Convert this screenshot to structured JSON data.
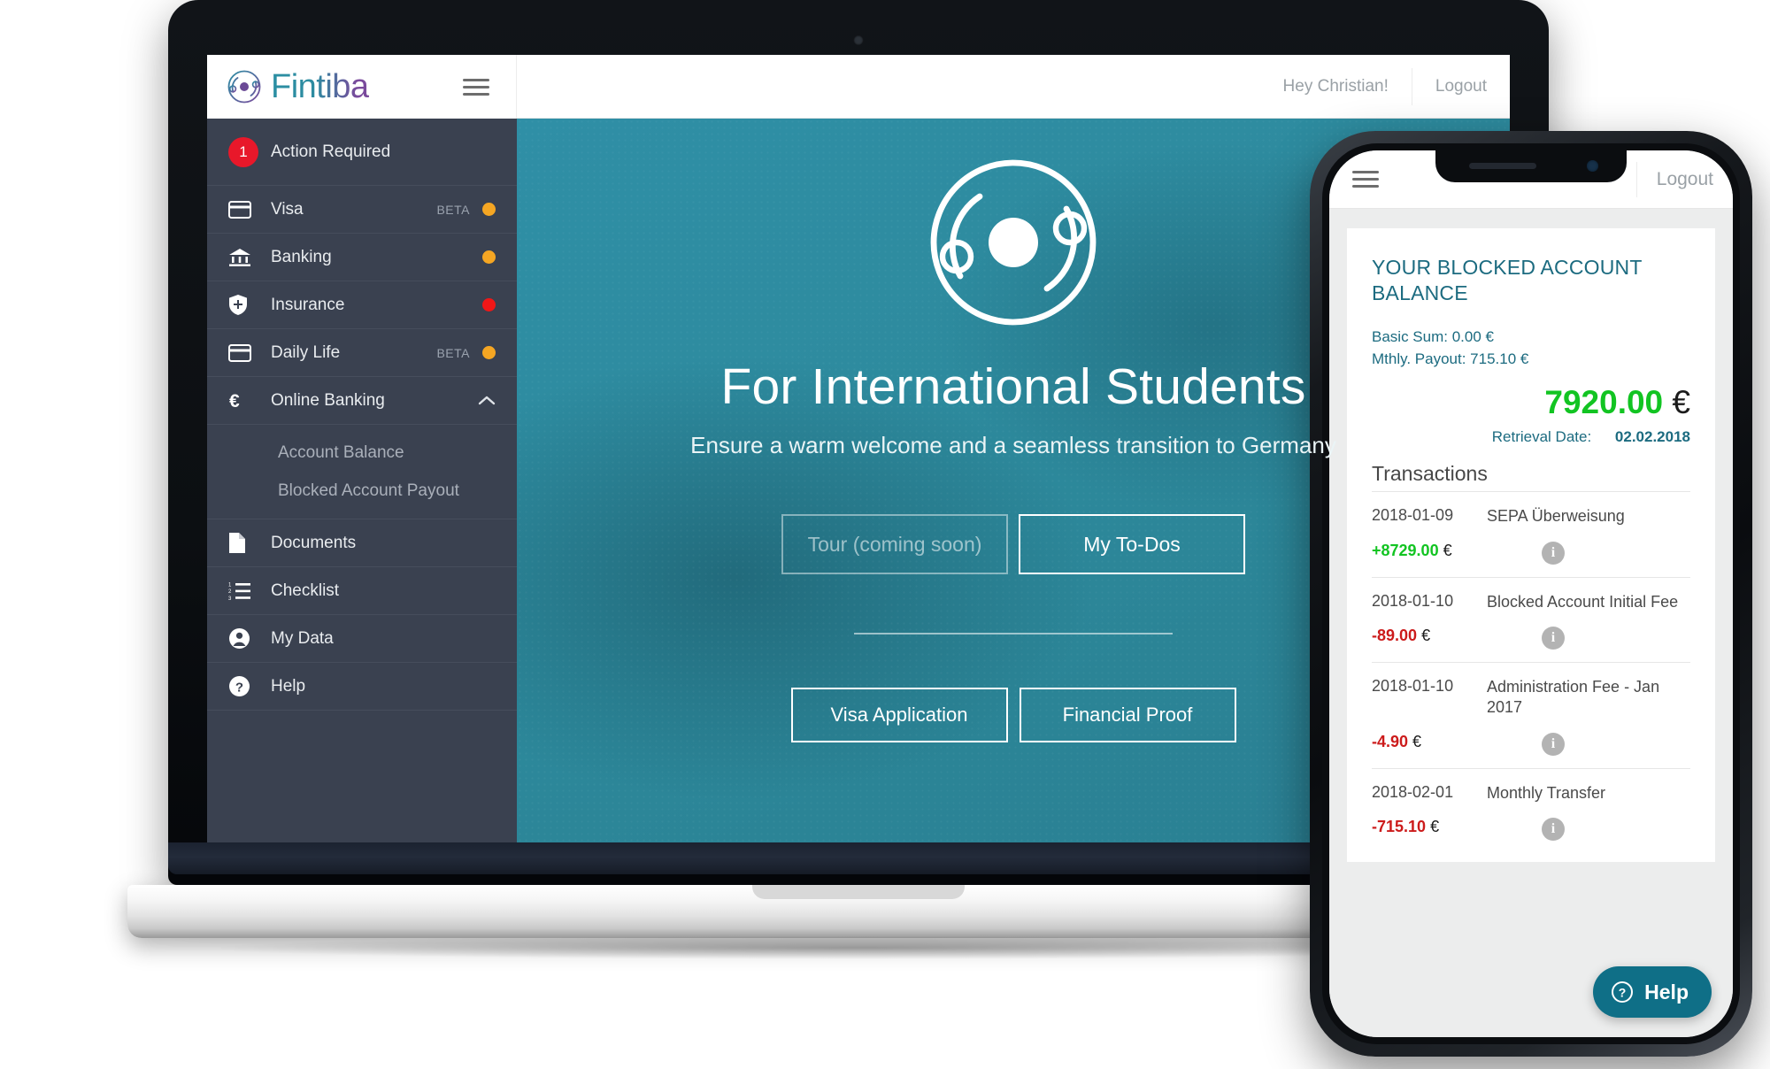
{
  "desktop": {
    "brand": {
      "name": "Fintiba"
    },
    "topbar": {
      "greeting": "Hey Christian!",
      "logout": "Logout"
    },
    "sidebar": {
      "action_required": {
        "label": "Action Required",
        "count": "1"
      },
      "items": [
        {
          "label": "Visa",
          "icon": "credit-card-icon",
          "beta": "BETA",
          "status": "amber"
        },
        {
          "label": "Banking",
          "icon": "bank-icon",
          "beta": "",
          "status": "amber"
        },
        {
          "label": "Insurance",
          "icon": "shield-icon",
          "beta": "",
          "status": "red"
        },
        {
          "label": "Daily Life",
          "icon": "credit-card-icon",
          "beta": "BETA",
          "status": "amber"
        }
      ],
      "online_banking": {
        "label": "Online Banking",
        "icon": "euro-icon",
        "expanded": true
      },
      "subitems": [
        {
          "label": "Account Balance"
        },
        {
          "label": "Blocked Account Payout"
        }
      ],
      "bottom_items": [
        {
          "label": "Documents",
          "icon": "document-icon"
        },
        {
          "label": "Checklist",
          "icon": "numbered-list-icon"
        },
        {
          "label": "My Data",
          "icon": "user-circle-icon"
        },
        {
          "label": "Help",
          "icon": "question-circle-icon"
        }
      ]
    },
    "hero": {
      "headline": "For International Students",
      "subheadline": "Ensure a warm welcome and a seamless transition to Germany",
      "primary_buttons": [
        {
          "label": "Tour (coming soon)",
          "disabled": true
        },
        {
          "label": "My To-Dos",
          "disabled": false
        }
      ],
      "secondary_buttons": [
        {
          "label": "Visa Application"
        },
        {
          "label": "Financial Proof"
        }
      ]
    }
  },
  "phone": {
    "topbar": {
      "logout": "Logout"
    },
    "card": {
      "title": "YOUR BLOCKED ACCOUNT BALANCE",
      "basic_sum": "Basic Sum: 0.00 €",
      "monthly_payout": "Mthly. Payout: 715.10 €",
      "balance_amount": "7920.00",
      "balance_currency": "€",
      "retrieval_label": "Retrieval Date:",
      "retrieval_date": "02.02.2018",
      "transactions_heading": "Transactions",
      "transactions": [
        {
          "date": "2018-01-09",
          "description": "SEPA Überweisung",
          "amount": "+8729.00",
          "currency": "€",
          "sign": "pos"
        },
        {
          "date": "2018-01-10",
          "description": "Blocked Account Initial Fee",
          "amount": "-89.00",
          "currency": "€",
          "sign": "neg"
        },
        {
          "date": "2018-01-10",
          "description": "Administration Fee - Jan 2017",
          "amount": "-4.90",
          "currency": "€",
          "sign": "neg"
        },
        {
          "date": "2018-02-01",
          "description": "Monthly Transfer",
          "amount": "-715.10",
          "currency": "€",
          "sign": "neg"
        }
      ]
    },
    "help_fab": {
      "label": "Help"
    }
  },
  "colors": {
    "brand_teal": "#2b8fa3",
    "brand_purple": "#7a4a9c",
    "sidebar_bg": "#3a4150",
    "hero_teal": "#2d8a9d",
    "positive_green": "#12c422",
    "negative_red": "#cc1b1b",
    "badge_red": "#e8182a",
    "status_amber": "#f5a623",
    "card_title": "#1c6b80"
  }
}
